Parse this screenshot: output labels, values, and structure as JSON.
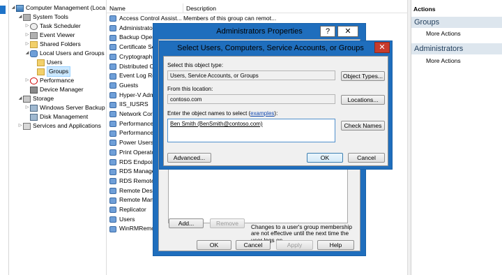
{
  "tree": {
    "items": [
      {
        "label": "Computer Management (Local",
        "arrow": "◢",
        "icon": "computer-icon"
      },
      {
        "label": "System Tools",
        "arrow": "◢",
        "icon": "tools-icon"
      },
      {
        "label": "Task Scheduler",
        "arrow": "▷",
        "icon": "clock-icon"
      },
      {
        "label": "Event Viewer",
        "arrow": "▷",
        "icon": "event-icon"
      },
      {
        "label": "Shared Folders",
        "arrow": "▷",
        "icon": "share-icon"
      },
      {
        "label": "Local Users and Groups",
        "arrow": "◢",
        "icon": "users-icon"
      },
      {
        "label": "Users",
        "arrow": "",
        "icon": "folder-icon"
      },
      {
        "label": "Groups",
        "arrow": "",
        "icon": "folder-icon"
      },
      {
        "label": "Performance",
        "arrow": "▷",
        "icon": "performance-icon"
      },
      {
        "label": "Device Manager",
        "arrow": "",
        "icon": "device-icon"
      },
      {
        "label": "Storage",
        "arrow": "◢",
        "icon": "storage-icon"
      },
      {
        "label": "Windows Server Backup",
        "arrow": "▷",
        "icon": "backup-icon"
      },
      {
        "label": "Disk Management",
        "arrow": "",
        "icon": "disk-icon"
      },
      {
        "label": "Services and Applications",
        "arrow": "▷",
        "icon": "services-icon"
      }
    ]
  },
  "list": {
    "col_name": "Name",
    "col_desc": "Description",
    "rows": [
      {
        "name": "Access Control Assist...",
        "desc": "Members of this group can remot..."
      },
      {
        "name": "Administrato",
        "desc": ""
      },
      {
        "name": "Backup Oper",
        "desc": ""
      },
      {
        "name": "Certificate Se",
        "desc": ""
      },
      {
        "name": "Cryptograph",
        "desc": ""
      },
      {
        "name": "Distributed C",
        "desc": ""
      },
      {
        "name": "Event Log Re",
        "desc": ""
      },
      {
        "name": "Guests",
        "desc": ""
      },
      {
        "name": "Hyper-V Adm",
        "desc": ""
      },
      {
        "name": "IIS_IUSRS",
        "desc": ""
      },
      {
        "name": "Network Cor",
        "desc": ""
      },
      {
        "name": "Performance",
        "desc": ""
      },
      {
        "name": "Performance",
        "desc": ""
      },
      {
        "name": "Power Users",
        "desc": ""
      },
      {
        "name": "Print Operato",
        "desc": ""
      },
      {
        "name": "RDS Endpoin",
        "desc": ""
      },
      {
        "name": "RDS Manage",
        "desc": ""
      },
      {
        "name": "RDS Remote",
        "desc": ""
      },
      {
        "name": "Remote Desk",
        "desc": ""
      },
      {
        "name": "Remote Man",
        "desc": ""
      },
      {
        "name": "Replicator",
        "desc": ""
      },
      {
        "name": "Users",
        "desc": ""
      },
      {
        "name": "WinRMRemo",
        "desc": ""
      }
    ]
  },
  "actions": {
    "title": "Actions",
    "section1": "Groups",
    "item1": "More Actions",
    "section2": "Administrators",
    "item2": "More Actions"
  },
  "props": {
    "title": "Administrators Properties",
    "help_btn": "?",
    "close_btn": "✕",
    "add_btn": "Add...",
    "remove_btn": "Remove",
    "note": "Changes to a user's group membership are not effective until the next time the user logs on.",
    "ok": "OK",
    "cancel": "Cancel",
    "apply": "Apply",
    "help": "Help"
  },
  "select": {
    "title": "Select Users, Computers, Service Accounts, or Groups",
    "close": "✕",
    "obj_type_label": "Select this object type:",
    "obj_type_value": "Users, Service Accounts, or Groups",
    "obj_types_btn": "Object Types...",
    "location_label": "From this location:",
    "location_value": "contoso.com",
    "locations_btn": "Locations...",
    "names_label_pre": "Enter the object names to select (",
    "names_label_link": "examples",
    "names_label_post": "):",
    "names_value": "Ben Smith (BenSmith@contoso.com)",
    "check_names_btn": "Check Names",
    "advanced_btn": "Advanced...",
    "ok": "OK",
    "cancel": "Cancel"
  },
  "colors": {
    "title_bar": "#1f6ebd",
    "close_red": "#c73b2c",
    "action_section": "#dde6ee",
    "selection": "#cce8ff"
  }
}
